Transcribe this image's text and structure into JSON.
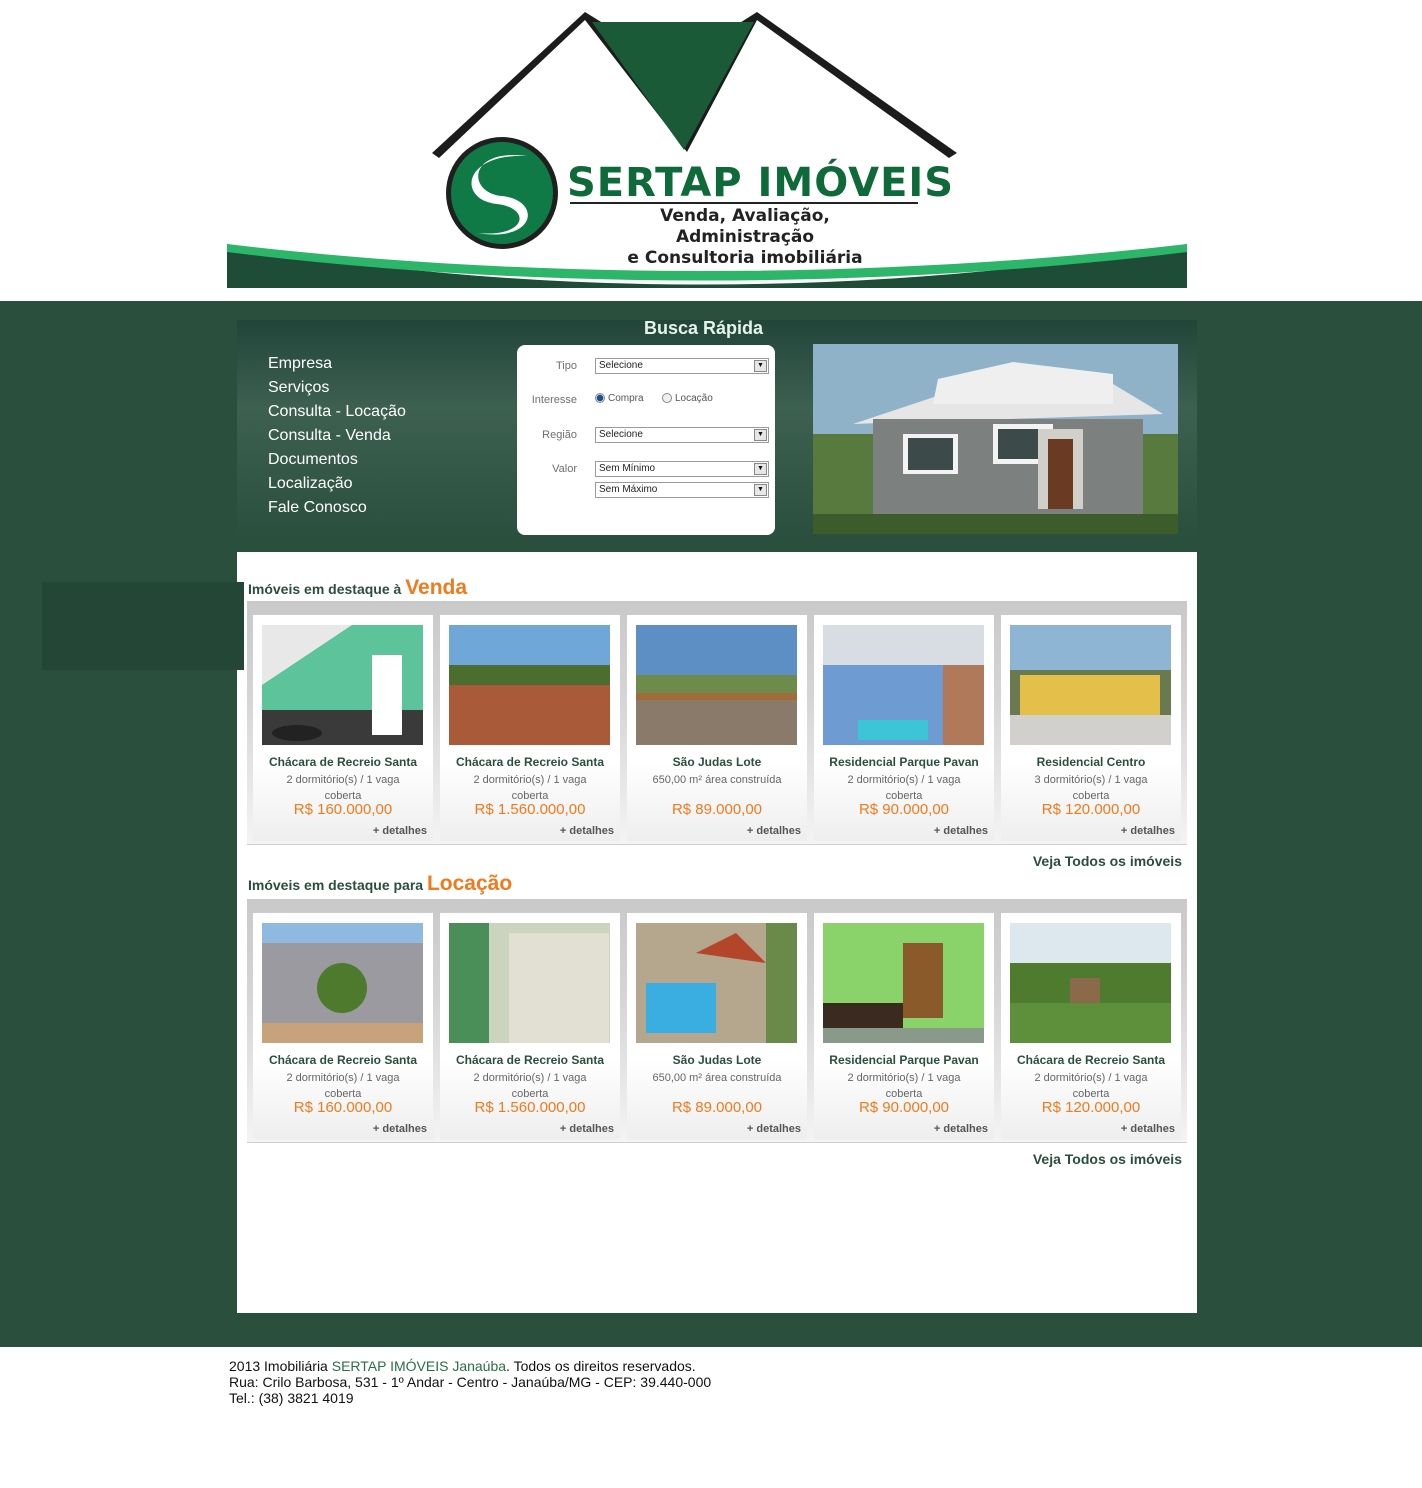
{
  "brand": {
    "name": "SERTAP IMÓVEIS",
    "tagline_1": "Venda, Avaliação, Administração",
    "tagline_2": "e Consultoria imobiliária",
    "color": "#0f6a3a"
  },
  "menu": {
    "items": [
      "Empresa",
      "Serviços",
      "Consulta - Locação",
      "Consulta - Venda",
      "Documentos",
      "Localização",
      "Fale Conosco"
    ]
  },
  "search": {
    "title": "Busca Rápida",
    "tipo_label": "Tipo",
    "tipo_value": "Selecione",
    "interesse_label": "Interesse",
    "interesse_options": [
      "Compra",
      "Locação"
    ],
    "interesse_selected": "Compra",
    "regiao_label": "Região",
    "regiao_value": "Selecione",
    "valor_label": "Valor",
    "valor_min": "Sem Mínimo",
    "valor_max": "Sem Máximo"
  },
  "venda": {
    "title_prefix": "Imóveis em destaque à",
    "title_big": "Venda",
    "see_all": "Veja Todos os imóveis",
    "cards": [
      {
        "name": "Chácara de Recreio Santa",
        "desc": "2 dormitório(s) / 1 vaga coberta",
        "price": "R$ 160.000,00",
        "more": "+ detalhes"
      },
      {
        "name": "Chácara de Recreio Santa",
        "desc": "2 dormitório(s) / 1 vaga coberta",
        "price": "R$ 1.560.000,00",
        "more": "+ detalhes"
      },
      {
        "name": "São Judas Lote",
        "desc": "650,00 m² área construída",
        "price": "R$ 89.000,00",
        "more": "+ detalhes"
      },
      {
        "name": "Residencial Parque Pavan",
        "desc": "2 dormitório(s) / 1 vaga coberta",
        "price": "R$ 90.000,00",
        "more": "+ detalhes"
      },
      {
        "name": "Residencial Centro",
        "desc": "3 dormitório(s) / 1 vaga coberta",
        "price": "R$ 120.000,00",
        "more": "+ detalhes"
      }
    ]
  },
  "locacao": {
    "title_prefix": "Imóveis em destaque para",
    "title_big": "Locação",
    "see_all": "Veja Todos os imóveis",
    "cards": [
      {
        "name": "Chácara de Recreio Santa",
        "desc": "2 dormitório(s) / 1 vaga coberta",
        "price": "R$ 160.000,00",
        "more": "+ detalhes"
      },
      {
        "name": "Chácara de Recreio Santa",
        "desc": "2 dormitório(s) / 1 vaga coberta",
        "price": "R$ 1.560.000,00",
        "more": "+ detalhes"
      },
      {
        "name": "São Judas Lote",
        "desc": "650,00 m² área construída",
        "price": "R$ 89.000,00",
        "more": "+ detalhes"
      },
      {
        "name": "Residencial Parque Pavan",
        "desc": "2 dormitório(s) / 1 vaga coberta",
        "price": "R$ 90.000,00",
        "more": "+ detalhes"
      },
      {
        "name": "Chácara de Recreio Santa",
        "desc": "2 dormitório(s) / 1 vaga coberta",
        "price": "R$ 120.000,00",
        "more": "+ detalhes"
      }
    ]
  },
  "footer": {
    "line1_a": "2013 Imobiliária ",
    "line1_b": "SERTAP IMÓVEIS Janaúba",
    "line1_c": ". Todos os direitos reservados.",
    "line2": "Rua: Crilo Barbosa, 531 - 1º Andar - Centro - Janaúba/MG - CEP: 39.440-000",
    "line3": "Tel.: (38) 3821 4019"
  }
}
